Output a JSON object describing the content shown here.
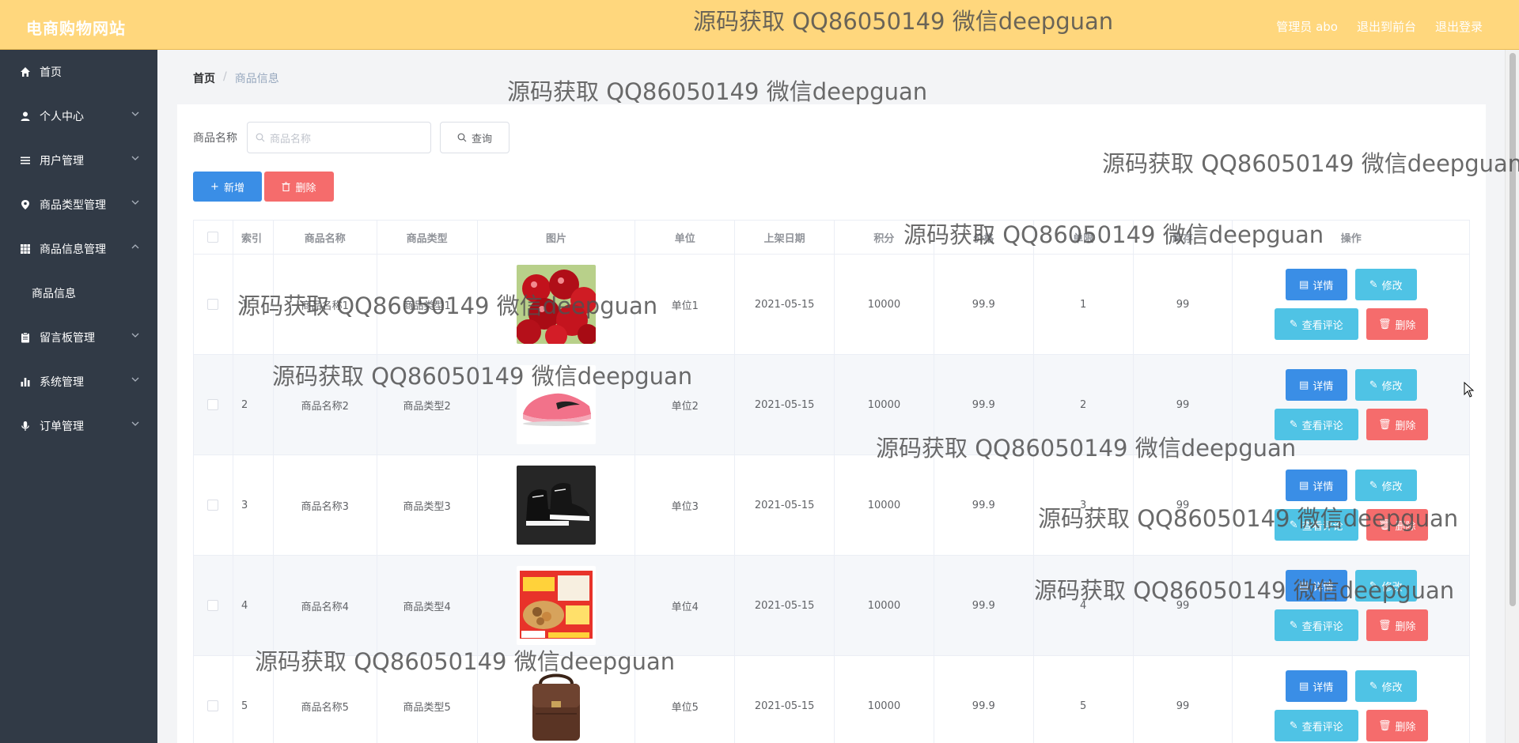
{
  "header": {
    "brand": "电商购物网站",
    "admin_label": "管理员 abo",
    "exit_front": "退出到前台",
    "logout": "退出登录"
  },
  "sidebar": {
    "items": [
      {
        "label": "首页",
        "icon": "home-icon",
        "has_chevron": false
      },
      {
        "label": "个人中心",
        "icon": "user-icon",
        "has_chevron": true
      },
      {
        "label": "用户管理",
        "icon": "list-icon",
        "has_chevron": true
      },
      {
        "label": "商品类型管理",
        "icon": "location-icon",
        "has_chevron": true
      },
      {
        "label": "商品信息管理",
        "icon": "grid-icon",
        "has_chevron": true,
        "expanded": true
      },
      {
        "label": "留言板管理",
        "icon": "clipboard-icon",
        "has_chevron": true
      },
      {
        "label": "系统管理",
        "icon": "bar-chart-icon",
        "has_chevron": true
      },
      {
        "label": "订单管理",
        "icon": "microphone-icon",
        "has_chevron": true
      }
    ],
    "subitem": "商品信息"
  },
  "breadcrumb": {
    "home": "首页",
    "separator": "/",
    "current": "商品信息"
  },
  "search": {
    "label": "商品名称",
    "placeholder": "商品名称",
    "query_button": "查询"
  },
  "actions": {
    "add": "新增",
    "delete": "删除"
  },
  "table": {
    "headers": {
      "index": "索引",
      "name": "商品名称",
      "type": "商品类型",
      "image": "图片",
      "unit": "单位",
      "date": "上架日期",
      "points": "积分",
      "price": "价格",
      "single": "单限",
      "stock": "库存",
      "ops": "操作"
    },
    "rows": [
      {
        "index": "1",
        "name": "商品名称1",
        "type": "商品类型1",
        "image": "cherries",
        "unit": "单位1",
        "date": "2021-05-15",
        "points": "10000",
        "price": "99.9",
        "single": "1",
        "stock": "99"
      },
      {
        "index": "2",
        "name": "商品名称2",
        "type": "商品类型2",
        "image": "pink-sneaker",
        "unit": "单位2",
        "date": "2021-05-15",
        "points": "10000",
        "price": "99.9",
        "single": "2",
        "stock": "99"
      },
      {
        "index": "3",
        "name": "商品名称3",
        "type": "商品类型3",
        "image": "black-high-tops",
        "unit": "单位3",
        "date": "2021-05-15",
        "points": "10000",
        "price": "99.9",
        "single": "3",
        "stock": "99"
      },
      {
        "index": "4",
        "name": "商品名称4",
        "type": "商品类型4",
        "image": "snack-box",
        "unit": "单位4",
        "date": "2021-05-15",
        "points": "10000",
        "price": "99.9",
        "single": "4",
        "stock": "99"
      },
      {
        "index": "5",
        "name": "商品名称5",
        "type": "商品类型5",
        "image": "brown-bag",
        "unit": "单位5",
        "date": "2021-05-15",
        "points": "10000",
        "price": "99.9",
        "single": "5",
        "stock": "99"
      }
    ],
    "row_buttons": {
      "detail": "详情",
      "edit": "修改",
      "review": "查看评论",
      "delete": "删除"
    }
  },
  "watermark": "源码获取 QQ86050149 微信deepguan",
  "colors": {
    "header": "#ffd77d",
    "sidebar": "#313a46",
    "primary": "#3a8ee6",
    "info": "#4fc3e5",
    "danger": "#f56c6c"
  }
}
